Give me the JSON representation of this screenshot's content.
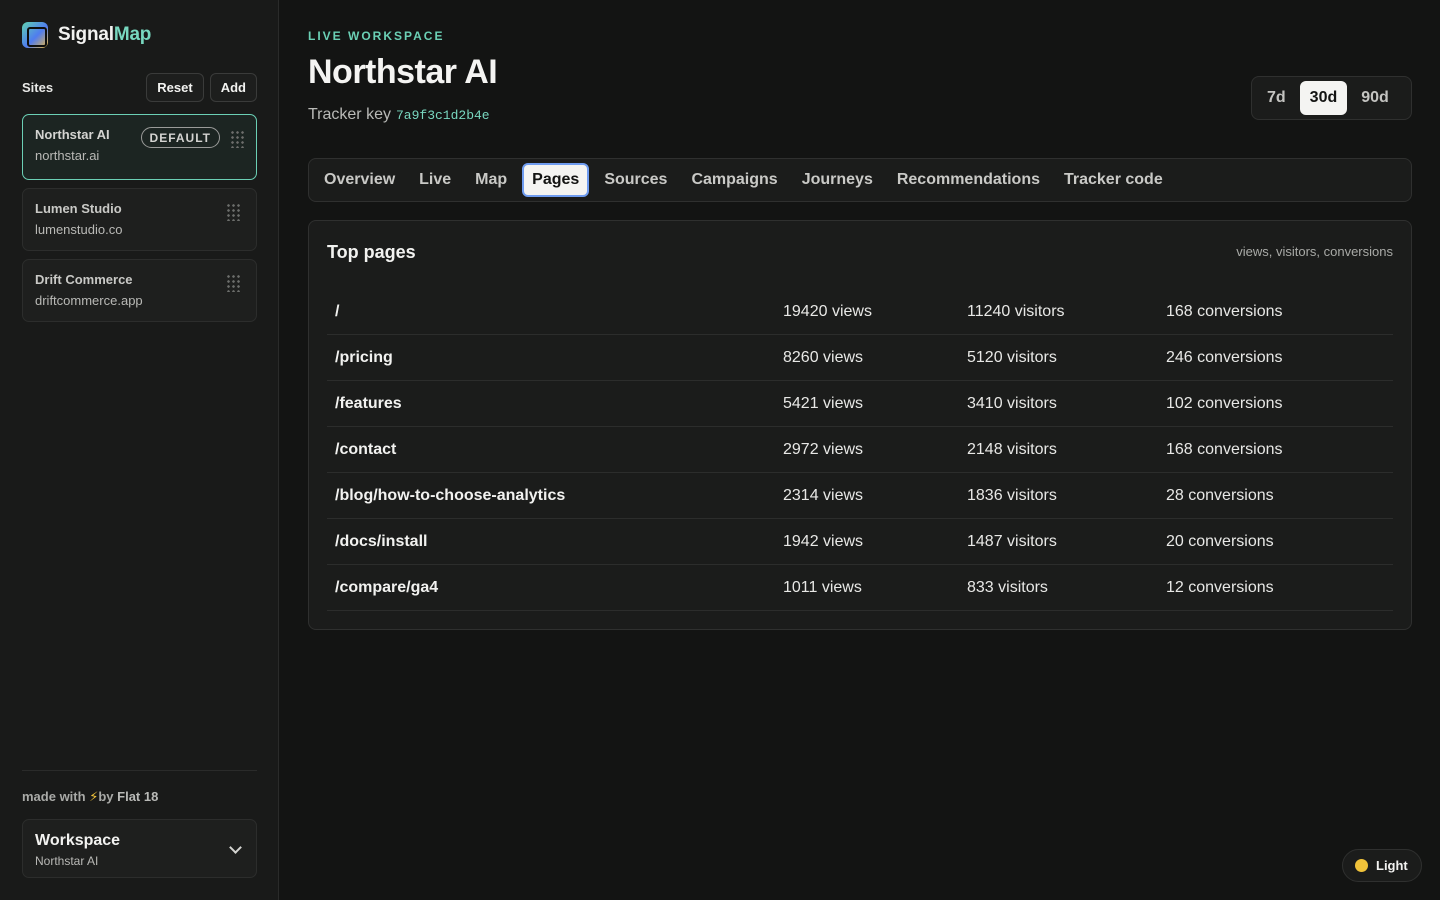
{
  "brand": {
    "name_part1": "Signal",
    "name_part2": "Map"
  },
  "sidebar": {
    "sites_title": "Sites",
    "reset_label": "Reset",
    "add_label": "Add",
    "sites": [
      {
        "name": "Northstar AI",
        "domain": "northstar.ai",
        "badge": "DEFAULT",
        "active": true
      },
      {
        "name": "Lumen Studio",
        "domain": "lumenstudio.co"
      },
      {
        "name": "Drift Commerce",
        "domain": "driftcommerce.app"
      }
    ],
    "made_with": {
      "prefix": "made with",
      "bolt": "⚡",
      "by": "by",
      "author": "Flat 18"
    },
    "workspace": {
      "title": "Workspace",
      "subtitle": "Northstar AI"
    }
  },
  "header": {
    "eyebrow": "LIVE WORKSPACE",
    "title": "Northstar AI",
    "tracker_label": "Tracker key",
    "tracker_key": "7a9f3c1d2b4e"
  },
  "range": {
    "options": [
      "7d",
      "30d",
      "90d"
    ],
    "selected": "30d"
  },
  "tabs": [
    {
      "label": "Overview"
    },
    {
      "label": "Live"
    },
    {
      "label": "Map"
    },
    {
      "label": "Pages",
      "active": true
    },
    {
      "label": "Sources"
    },
    {
      "label": "Campaigns"
    },
    {
      "label": "Journeys"
    },
    {
      "label": "Recommendations"
    },
    {
      "label": "Tracker code"
    }
  ],
  "panel": {
    "title": "Top pages",
    "meta": "views, visitors, conversions",
    "rows": [
      {
        "path": "/",
        "views": "19420 views",
        "visitors": "11240 visitors",
        "conversions": "168 conversions"
      },
      {
        "path": "/pricing",
        "views": "8260 views",
        "visitors": "5120 visitors",
        "conversions": "246 conversions"
      },
      {
        "path": "/features",
        "views": "5421 views",
        "visitors": "3410 visitors",
        "conversions": "102 conversions"
      },
      {
        "path": "/contact",
        "views": "2972 views",
        "visitors": "2148 visitors",
        "conversions": "168 conversions"
      },
      {
        "path": "/blog/how-to-choose-analytics",
        "views": "2314 views",
        "visitors": "1836 visitors",
        "conversions": "28 conversions"
      },
      {
        "path": "/docs/install",
        "views": "1942 views",
        "visitors": "1487 visitors",
        "conversions": "20 conversions"
      },
      {
        "path": "/compare/ga4",
        "views": "1011 views",
        "visitors": "833 visitors",
        "conversions": "12 conversions"
      }
    ]
  },
  "theme_toggle": {
    "label": "Light"
  },
  "colors": {
    "accent": "#6bd0b5",
    "background": "#131413",
    "sidebar": "#191a19",
    "sun": "#f0c23a"
  }
}
